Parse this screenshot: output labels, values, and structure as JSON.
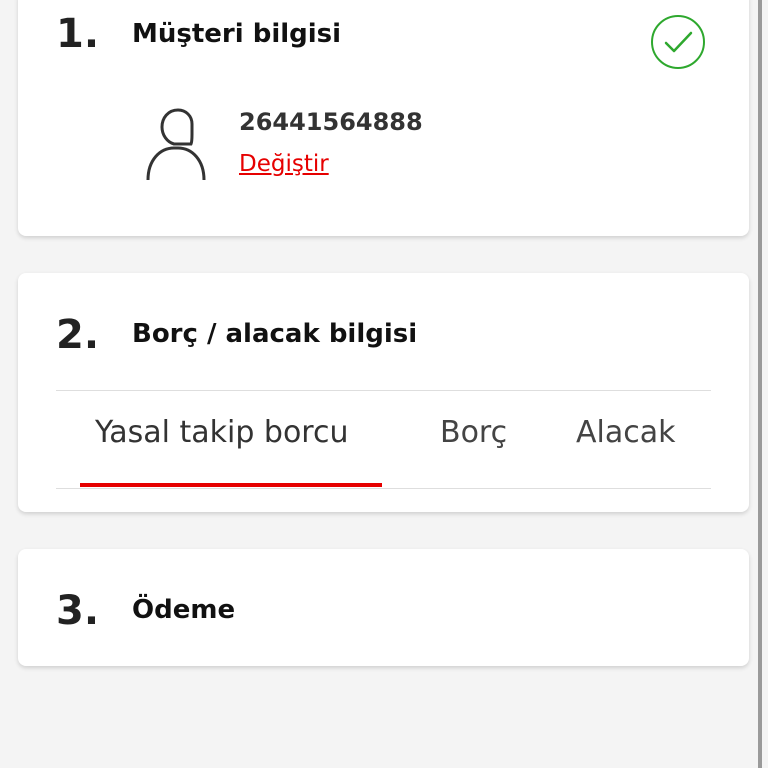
{
  "steps": [
    {
      "number": "1.",
      "title": "Müşteri bilgisi",
      "status": "completed"
    },
    {
      "number": "2.",
      "title": "Borç / alacak bilgisi"
    },
    {
      "number": "3.",
      "title": "Ödeme"
    }
  ],
  "customer": {
    "id": "26441564888",
    "change_label": "Değiştir"
  },
  "tabs": [
    {
      "label": "Yasal takip borcu",
      "active": true
    },
    {
      "label": "Borç",
      "active": false
    },
    {
      "label": "Alacak",
      "active": false
    }
  ],
  "colors": {
    "accent": "#e60000",
    "success": "#2ea82e",
    "background": "#f4f4f4",
    "card": "#ffffff"
  },
  "icons": [
    "check-circle-icon",
    "user-icon"
  ]
}
